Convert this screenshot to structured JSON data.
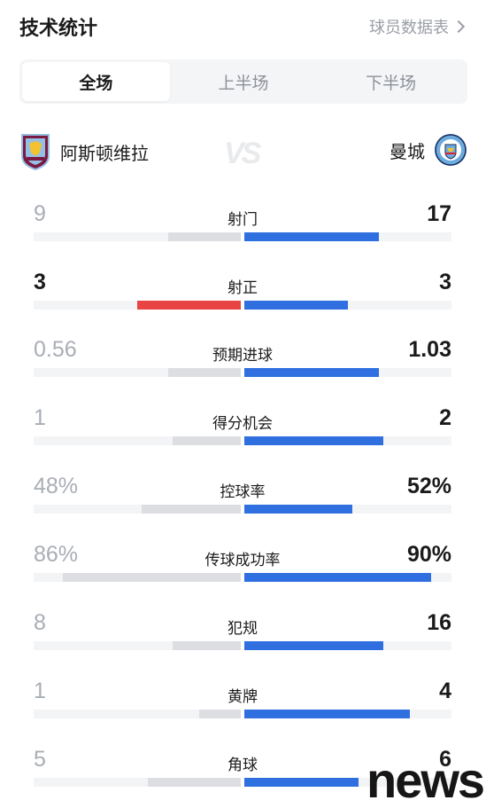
{
  "header": {
    "title": "技术统计",
    "link_label": "球员数据表"
  },
  "tabs": [
    {
      "label": "全场",
      "active": true
    },
    {
      "label": "上半场",
      "active": false
    },
    {
      "label": "下半场",
      "active": false
    }
  ],
  "teams": {
    "home": {
      "name": "阿斯顿维拉",
      "crest_icon": "aston-villa-crest-icon",
      "color": "#670e36"
    },
    "away": {
      "name": "曼城",
      "crest_icon": "manchester-city-crest-icon",
      "color": "#6cabdd"
    },
    "vs_label": "VS"
  },
  "colors": {
    "home_bar": "#dcdee2",
    "home_bar_highlight": "#e84444",
    "away_bar": "#2f6fe0",
    "track": "#f3f4f6"
  },
  "stats": [
    {
      "label": "射门",
      "home": "9",
      "away": "17",
      "home_share": 0.35,
      "away_share": 0.65,
      "home_fill": 0.35,
      "away_fill": 0.65,
      "home_highlight": false
    },
    {
      "label": "射正",
      "home": "3",
      "away": "3",
      "home_share": 0.5,
      "away_share": 0.5,
      "home_fill": 0.5,
      "away_fill": 0.5,
      "home_highlight": true
    },
    {
      "label": "预期进球",
      "home": "0.56",
      "away": "1.03",
      "home_share": 0.35,
      "away_share": 0.65,
      "home_fill": 0.35,
      "away_fill": 0.65,
      "home_highlight": false
    },
    {
      "label": "得分机会",
      "home": "1",
      "away": "2",
      "home_share": 0.33,
      "away_share": 0.67,
      "home_fill": 0.33,
      "away_fill": 0.67,
      "home_highlight": false
    },
    {
      "label": "控球率",
      "home": "48%",
      "away": "52%",
      "home_share": 0.48,
      "away_share": 0.52,
      "home_fill": 0.48,
      "away_fill": 0.52,
      "home_highlight": false
    },
    {
      "label": "传球成功率",
      "home": "86%",
      "away": "90%",
      "home_share": 0.86,
      "away_share": 0.9,
      "home_fill": 0.86,
      "away_fill": 0.9,
      "home_highlight": false
    },
    {
      "label": "犯规",
      "home": "8",
      "away": "16",
      "home_share": 0.33,
      "away_share": 0.67,
      "home_fill": 0.33,
      "away_fill": 0.67,
      "home_highlight": false
    },
    {
      "label": "黄牌",
      "home": "1",
      "away": "4",
      "home_share": 0.2,
      "away_share": 0.8,
      "home_fill": 0.2,
      "away_fill": 0.8,
      "home_highlight": false
    },
    {
      "label": "角球",
      "home": "5",
      "away": "6",
      "home_share": 0.45,
      "away_share": 0.55,
      "home_fill": 0.45,
      "away_fill": 0.55,
      "home_highlight": false
    }
  ],
  "watermark": "news"
}
